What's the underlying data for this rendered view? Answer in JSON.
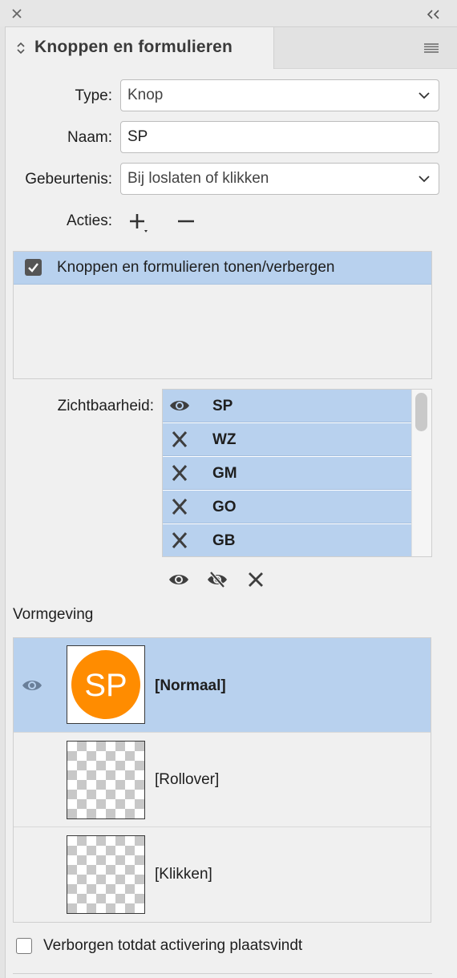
{
  "panel": {
    "title": "Knoppen en formulieren"
  },
  "form": {
    "type_label": "Type:",
    "type_value": "Knop",
    "name_label": "Naam:",
    "name_value": "SP",
    "event_label": "Gebeurtenis:",
    "event_value": "Bij loslaten of klikken",
    "actions_label": "Acties:"
  },
  "actions": {
    "items": [
      {
        "label": "Knoppen en formulieren tonen/verbergen",
        "checked": true
      }
    ]
  },
  "visibility": {
    "label": "Zichtbaarheid:",
    "items": [
      {
        "icon": "eye-icon",
        "name": "SP"
      },
      {
        "icon": "x-icon",
        "name": "WZ"
      },
      {
        "icon": "x-icon",
        "name": "GM"
      },
      {
        "icon": "x-icon",
        "name": "GO"
      },
      {
        "icon": "x-icon",
        "name": "GB"
      }
    ]
  },
  "appearance": {
    "label": "Vormgeving",
    "states": [
      {
        "label": "[Normaal]",
        "selected": true,
        "thumb_text": "SP",
        "thumb_color": "#ff8c00"
      },
      {
        "label": "[Rollover]",
        "selected": false
      },
      {
        "label": "[Klikken]",
        "selected": false
      }
    ]
  },
  "footer": {
    "hidden_until_label": "Verborgen totdat activering plaatsvindt",
    "hidden_until_checked": false
  },
  "colors": {
    "selection": "#b8d1ee",
    "accent_orange": "#ff8c00"
  }
}
